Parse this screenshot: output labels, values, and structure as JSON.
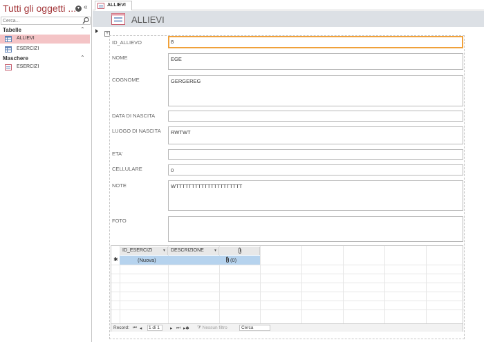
{
  "nav": {
    "title": "Tutti gli oggetti ...",
    "search_placeholder": "Cerca...",
    "groups": [
      {
        "label": "Tabelle",
        "items": [
          "ALLIEVI",
          "ESERCIZI"
        ]
      },
      {
        "label": "Maschere",
        "items": [
          "ESERCIZI"
        ]
      }
    ],
    "selected_item": "ALLIEVI",
    "selected_color": "#f4c4c6"
  },
  "tab": {
    "label": "ALLIEVI"
  },
  "form": {
    "title": "ALLIEVI",
    "fields": [
      {
        "label": "ID_ALLIEVO",
        "value": "8"
      },
      {
        "label": "NOME",
        "value": "EGE"
      },
      {
        "label": "COGNOME",
        "value": "GERGEREG"
      },
      {
        "label": "DATA DI NASCITA",
        "value": ""
      },
      {
        "label": "LUOGO DI NASCITA",
        "value": "RWTWT"
      },
      {
        "label": "ETA'",
        "value": ""
      },
      {
        "label": "CELLULARE",
        "value": "0"
      },
      {
        "label": "NOTE",
        "value": "WTTTTTTTTTTTTTTTTTTTTT"
      },
      {
        "label": "FOTO",
        "value": ""
      }
    ],
    "focus_color": "#f0a13b"
  },
  "subform": {
    "columns": [
      "ID_ESERCIZI",
      "DESCRIZIONE"
    ],
    "new_row_label": "(Nuova)",
    "attachment_count": "(0)",
    "row_highlight": "#b6d3ee",
    "navbar": {
      "record_label": "Record:",
      "position": "1 di 1",
      "filter_label": "Nessun filtro",
      "search_label": "Cerca"
    }
  },
  "icons": [
    "search-icon",
    "table-icon",
    "form-icon",
    "paperclip-icon",
    "chevron-up-icon",
    "collapse-icon",
    "dropdown-icon"
  ]
}
